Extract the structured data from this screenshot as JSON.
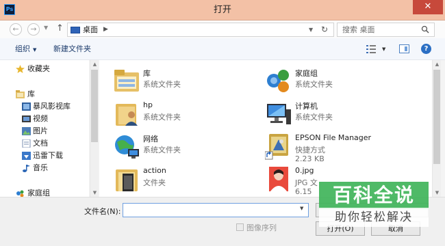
{
  "window": {
    "title": "打开",
    "app_icon": "Ps",
    "close_label": "✕"
  },
  "address": {
    "location": "桌面",
    "search_placeholder": "搜索 桌面"
  },
  "toolbar": {
    "organize": "组织",
    "new_folder": "新建文件夹"
  },
  "nav": {
    "items": [
      {
        "label": "收藏夹",
        "icon": "star-icon"
      },
      {
        "label": "库",
        "icon": "library-icon"
      },
      {
        "label": "暴风影视库",
        "icon": "video-library-icon"
      },
      {
        "label": "视频",
        "icon": "video-icon"
      },
      {
        "label": "图片",
        "icon": "pictures-icon"
      },
      {
        "label": "文档",
        "icon": "documents-icon"
      },
      {
        "label": "迅雷下载",
        "icon": "download-icon"
      },
      {
        "label": "音乐",
        "icon": "music-icon"
      },
      {
        "label": "家庭组",
        "icon": "homegroup-icon"
      }
    ]
  },
  "files": [
    {
      "name": "库",
      "type": "系统文件夹",
      "size": "",
      "icon": "library-folder-icon"
    },
    {
      "name": "家庭组",
      "type": "系统文件夹",
      "size": "",
      "icon": "homegroup-icon"
    },
    {
      "name": "hp",
      "type": "系统文件夹",
      "size": "",
      "icon": "user-folder-icon"
    },
    {
      "name": "计算机",
      "type": "系统文件夹",
      "size": "",
      "icon": "computer-icon"
    },
    {
      "name": "网络",
      "type": "系统文件夹",
      "size": "",
      "icon": "network-icon"
    },
    {
      "name": "EPSON File Manager",
      "type": "快捷方式",
      "size": "2.23 KB",
      "icon": "shortcut-icon"
    },
    {
      "name": "action",
      "type": "文件夹",
      "size": "",
      "icon": "folder-icon"
    },
    {
      "name": "0.jpg",
      "type": "JPG 文",
      "size": "6.15",
      "icon": "photo-thumbnail-icon"
    }
  ],
  "bottom": {
    "filename_label": "文件名(N):",
    "filename_value": "",
    "image_sequence_label": "图像序列",
    "open_label": "打开(O)",
    "cancel_label": "取消"
  },
  "watermark": {
    "title": "百科全说",
    "subtitle": "助你轻松解决"
  },
  "colors": {
    "titlebar": "#f3c1a6",
    "close": "#c7493b",
    "watermark_green": "#40b45a",
    "link": "#1c3b6b"
  }
}
